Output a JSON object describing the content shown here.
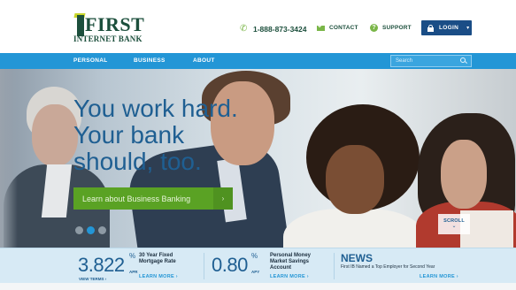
{
  "brand": {
    "name": "FIRST",
    "subname": "INTERNET BANK",
    "colors": {
      "green": "#1c4f3c",
      "lime": "#c8d62b",
      "blue": "#2396d6",
      "navy": "#1a4d86",
      "cta_green": "#5aa224"
    }
  },
  "header": {
    "phone": "1-888-873-3424",
    "contact_label": "CONTACT",
    "support_label": "SUPPORT",
    "login_label": "LOGIN",
    "icons": {
      "phone": "phone-icon",
      "contact": "envelope-icon",
      "support": "question-icon",
      "login": "lock-icon"
    }
  },
  "nav": {
    "items": [
      "PERSONAL",
      "BUSINESS",
      "ABOUT"
    ],
    "search_placeholder": "Search"
  },
  "hero": {
    "headline_lines": [
      "You work hard.",
      "Your bank",
      "should, too."
    ],
    "cta_label": "Learn about Business Banking",
    "scroll_label": "SCROLL",
    "carousel": {
      "slide_count": 3,
      "active_index": 1
    }
  },
  "rates": [
    {
      "value": "3.822",
      "unit": "%",
      "tag": "APR",
      "desc_lines": [
        "30 Year Fixed",
        "Mortgage Rate"
      ],
      "extra": "VIEW TERMS ›",
      "link": "LEARN MORE ›"
    },
    {
      "value": "0.80",
      "unit": "%",
      "tag": "APY",
      "desc_lines": [
        "Personal Money",
        "Market Savings",
        "Account"
      ],
      "link": "LEARN MORE ›"
    }
  ],
  "news": {
    "title": "NEWS",
    "text": "First IB Named a Top Employer for Second Year",
    "link": "LEARN MORE ›"
  }
}
